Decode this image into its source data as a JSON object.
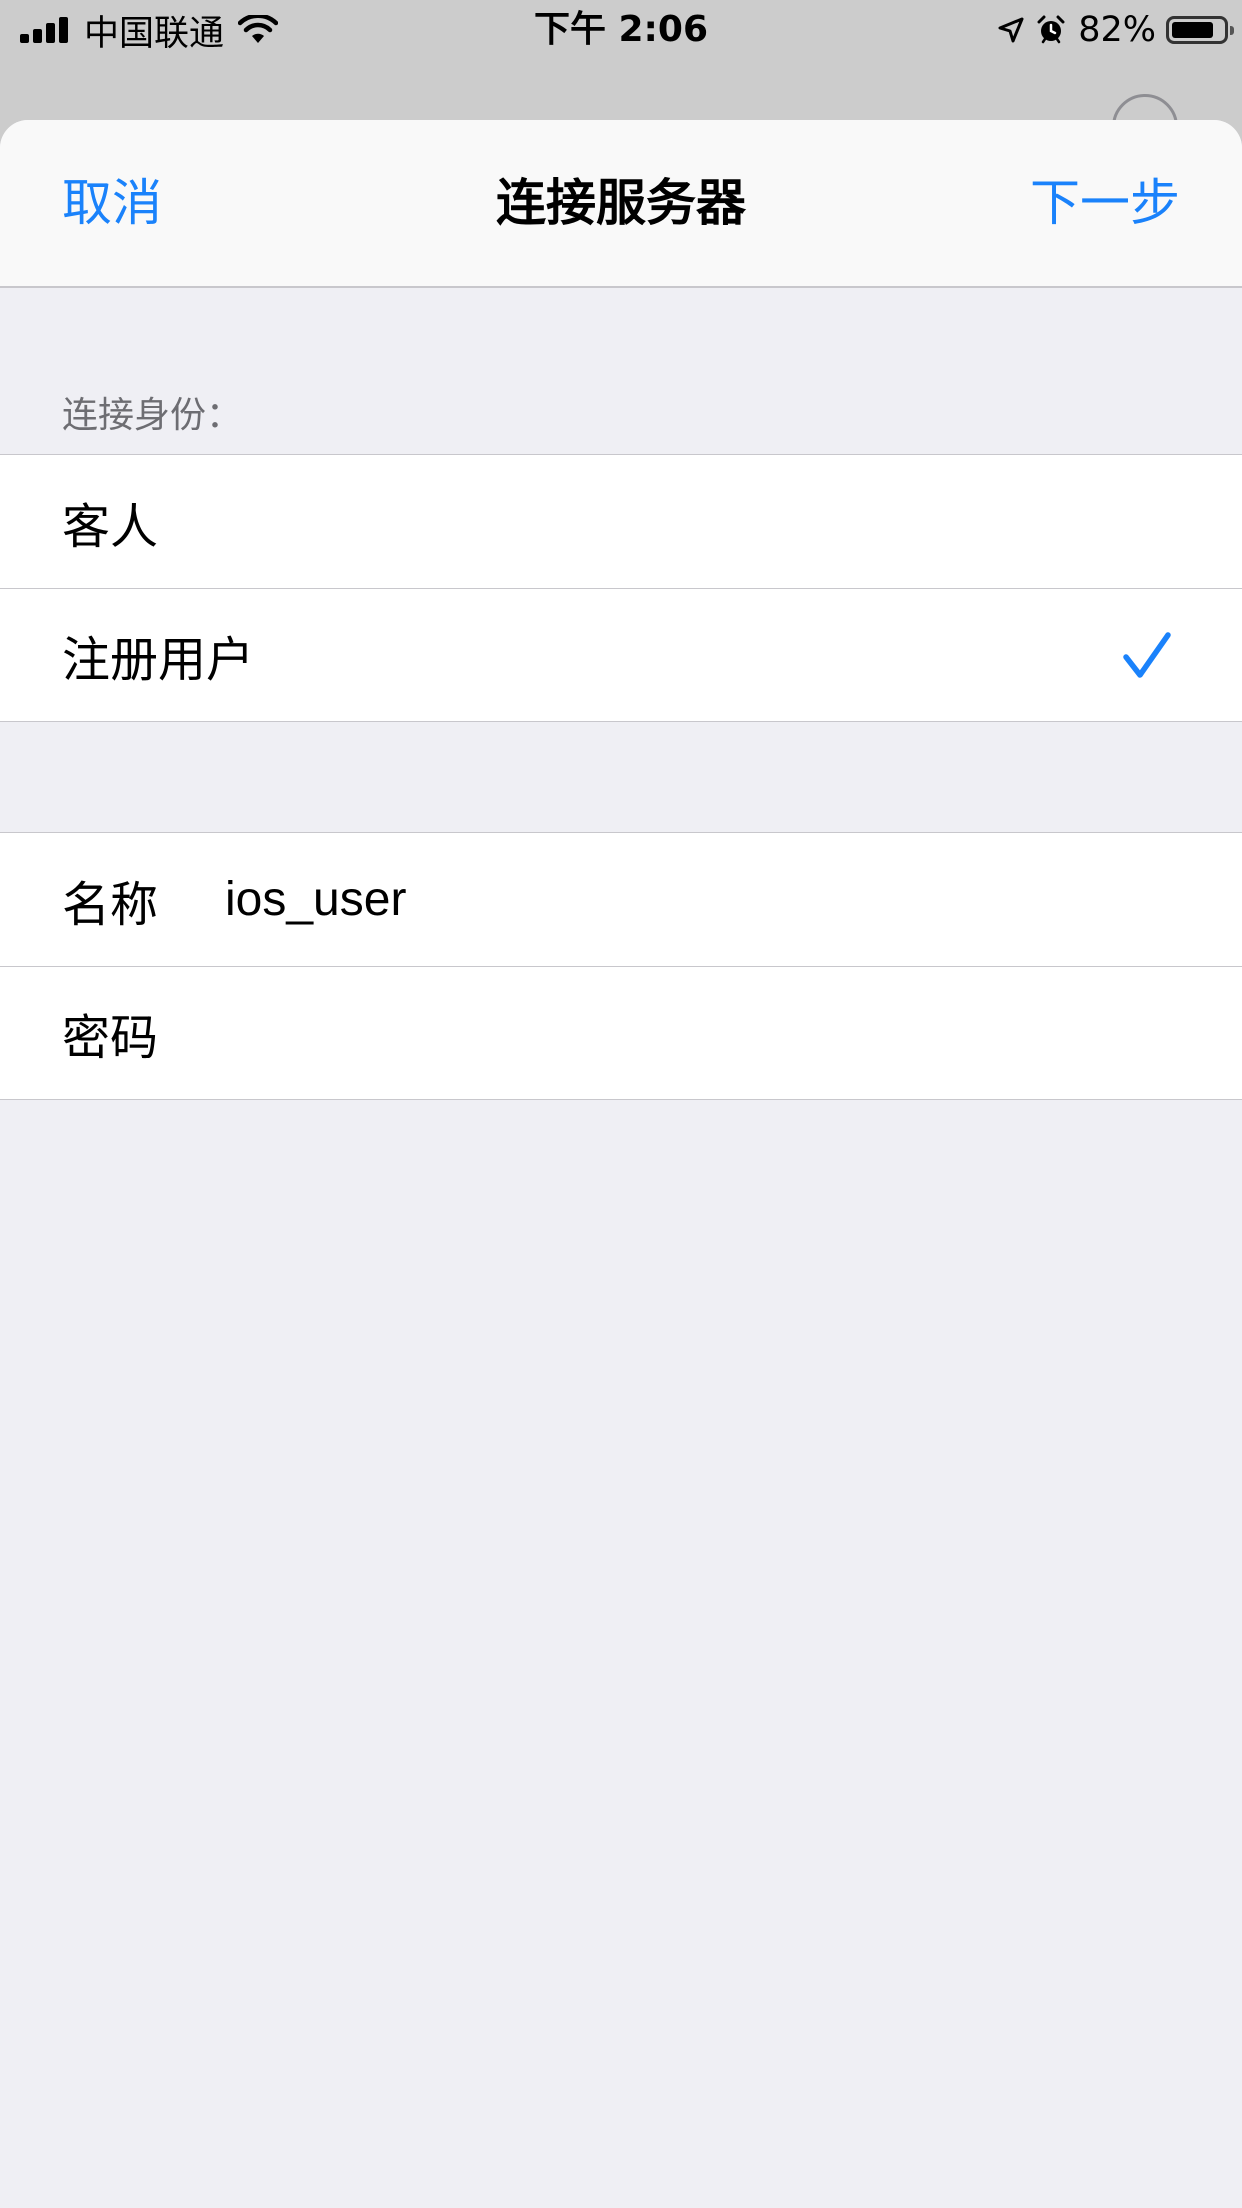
{
  "status_bar": {
    "carrier": "中国联通",
    "time": "下午 2:06",
    "battery_percent": "82%",
    "battery_level": 0.82,
    "icons": [
      "signal-icon",
      "wifi-icon",
      "location-arrow-icon",
      "alarm-icon",
      "battery-icon"
    ]
  },
  "nav": {
    "cancel_label": "取消",
    "title": "连接服务器",
    "next_label": "下一步"
  },
  "identity": {
    "header": "连接身份：",
    "options": [
      {
        "label": "客人",
        "selected": false
      },
      {
        "label": "注册用户",
        "selected": true
      }
    ]
  },
  "credentials": {
    "name_label": "名称",
    "name_value": "ios_user",
    "password_label": "密码",
    "password_value": ""
  },
  "colors": {
    "accent": "#1a82fb",
    "background": "#efeff4",
    "separator": "#c8c7cc",
    "secondary_text": "#6d6d72"
  }
}
